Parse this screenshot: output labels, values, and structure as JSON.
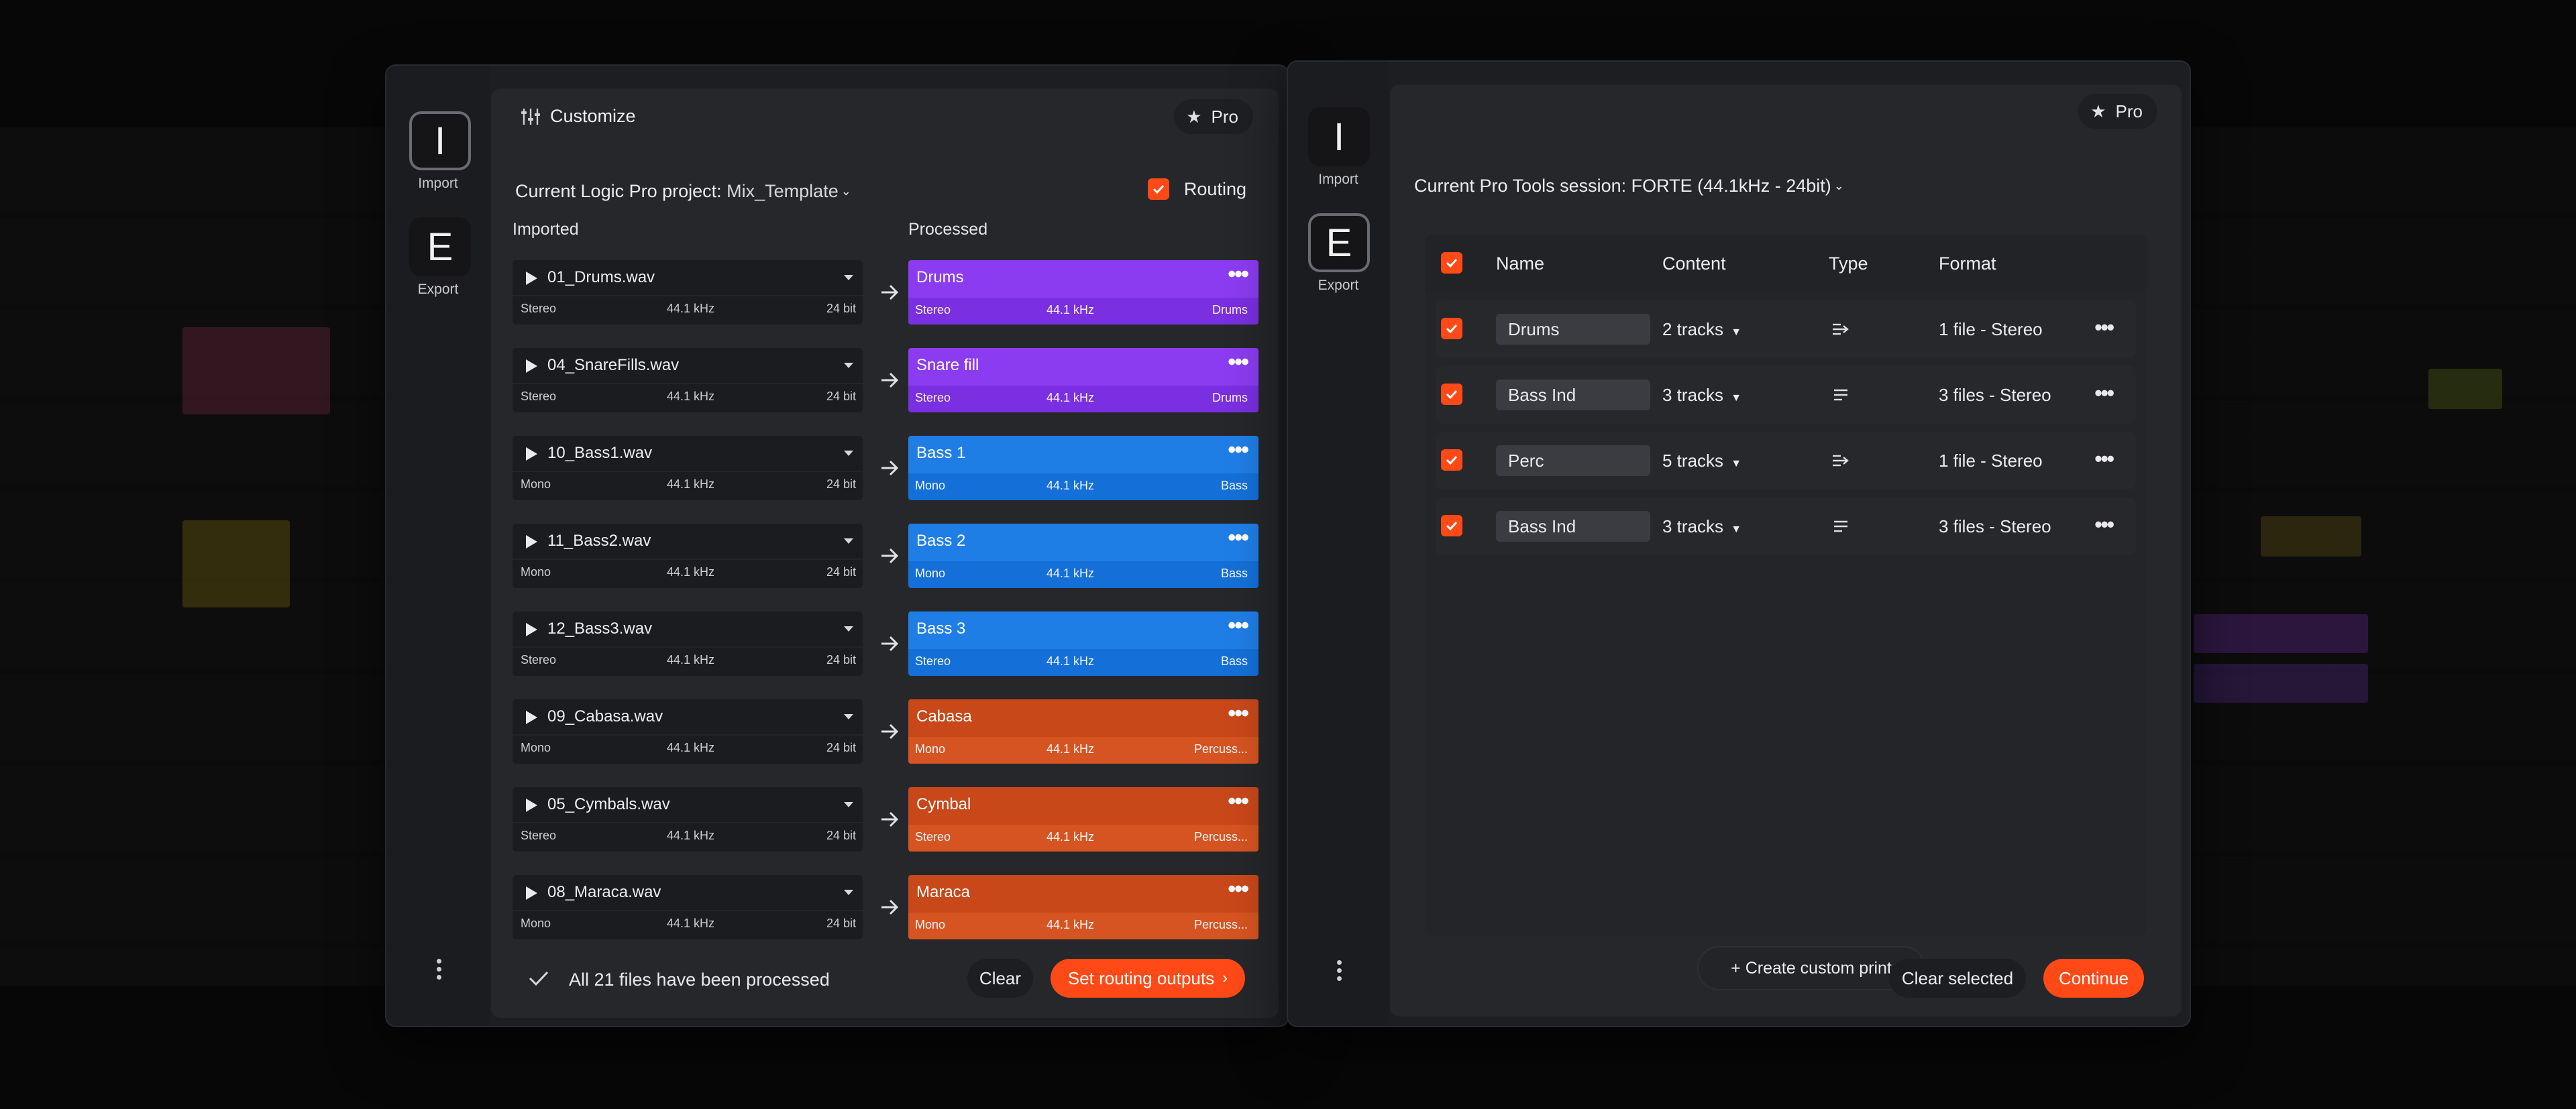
{
  "left_window": {
    "rail": {
      "import_letter": "I",
      "import_label": "Import",
      "export_letter": "E",
      "export_label": "Export"
    },
    "header": {
      "title": "Customize",
      "pro_label": "Pro"
    },
    "project": {
      "label": "Current Logic Pro project:",
      "value": "Mix_Template"
    },
    "routing_label": "Routing",
    "columns": {
      "imported": "Imported",
      "processed": "Processed"
    },
    "rows": [
      {
        "file": "01_Drums.wav",
        "channels": "Stereo",
        "rate": "44.1 kHz",
        "bits": "24 bit",
        "track": "Drums",
        "p_channels": "Stereo",
        "p_rate": "44.1 kHz",
        "group": "Drums",
        "color_top": "#8b3cf0",
        "color_bot": "#7a2fe0"
      },
      {
        "file": "04_SnareFills.wav",
        "channels": "Stereo",
        "rate": "44.1 kHz",
        "bits": "24 bit",
        "track": "Snare fill",
        "p_channels": "Stereo",
        "p_rate": "44.1 kHz",
        "group": "Drums",
        "color_top": "#8b3cf0",
        "color_bot": "#7a2fe0"
      },
      {
        "file": "10_Bass1.wav",
        "channels": "Mono",
        "rate": "44.1 kHz",
        "bits": "24 bit",
        "track": "Bass 1",
        "p_channels": "Mono",
        "p_rate": "44.1 kHz",
        "group": "Bass",
        "color_top": "#1f7ee6",
        "color_bot": "#1470d8"
      },
      {
        "file": "11_Bass2.wav",
        "channels": "Mono",
        "rate": "44.1 kHz",
        "bits": "24 bit",
        "track": "Bass 2",
        "p_channels": "Mono",
        "p_rate": "44.1 kHz",
        "group": "Bass",
        "color_top": "#1f7ee6",
        "color_bot": "#1470d8"
      },
      {
        "file": "12_Bass3.wav",
        "channels": "Stereo",
        "rate": "44.1 kHz",
        "bits": "24 bit",
        "track": "Bass 3",
        "p_channels": "Stereo",
        "p_rate": "44.1 kHz",
        "group": "Bass",
        "color_top": "#1f7ee6",
        "color_bot": "#1470d8"
      },
      {
        "file": "09_Cabasa.wav",
        "channels": "Mono",
        "rate": "44.1 kHz",
        "bits": "24 bit",
        "track": "Cabasa",
        "p_channels": "Mono",
        "p_rate": "44.1 kHz",
        "group": "Percuss...",
        "color_top": "#c8481a",
        "color_bot": "#d65421"
      },
      {
        "file": "05_Cymbals.wav",
        "channels": "Stereo",
        "rate": "44.1 kHz",
        "bits": "24 bit",
        "track": "Cymbal",
        "p_channels": "Stereo",
        "p_rate": "44.1 kHz",
        "group": "Percuss...",
        "color_top": "#c8481a",
        "color_bot": "#d65421"
      },
      {
        "file": "08_Maraca.wav",
        "channels": "Mono",
        "rate": "44.1 kHz",
        "bits": "24 bit",
        "track": "Maraca",
        "p_channels": "Mono",
        "p_rate": "44.1 kHz",
        "group": "Percuss...",
        "color_top": "#c8481a",
        "color_bot": "#d65421"
      }
    ],
    "footer": {
      "message": "All 21 files have been processed",
      "clear_label": "Clear",
      "primary_label": "Set routing outputs"
    }
  },
  "right_window": {
    "rail": {
      "import_letter": "I",
      "import_label": "Import",
      "export_letter": "E",
      "export_label": "Export"
    },
    "pro_label": "Pro",
    "session": {
      "label": "Current Pro Tools session:",
      "value": "FORTE (44.1kHz - 24bit)"
    },
    "table": {
      "headers": {
        "name": "Name",
        "content": "Content",
        "type": "Type",
        "format": "Format"
      },
      "rows": [
        {
          "name": "Drums",
          "content": "2 tracks",
          "type_icon": "merge-lines-icon",
          "format": "1 file - Stereo"
        },
        {
          "name": "Bass Ind",
          "content": "3 tracks",
          "type_icon": "split-lines-icon",
          "format": "3 files - Stereo"
        },
        {
          "name": "Perc",
          "content": "5 tracks",
          "type_icon": "merge-lines-icon",
          "format": "1 file - Stereo"
        },
        {
          "name": "Bass Ind",
          "content": "3 tracks",
          "type_icon": "split-lines-icon",
          "format": "3 files - Stereo"
        }
      ]
    },
    "create_label": "+ Create custom print",
    "clear_selected_label": "Clear selected",
    "continue_label": "Continue"
  },
  "colors": {
    "accent": "#ff4a17",
    "panel": "#26272b",
    "window": "#1d1e21"
  }
}
